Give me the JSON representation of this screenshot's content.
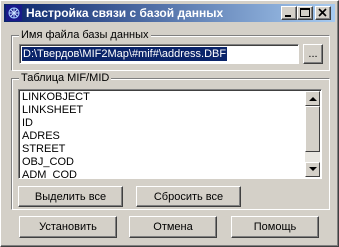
{
  "window": {
    "title": "Настройка связи с базой данных",
    "icon": "app-logo-icon"
  },
  "titlebar_buttons": {
    "minimize": "_",
    "maximize": "□",
    "close": "✕"
  },
  "file_group": {
    "label": "Имя файла базы данных",
    "path_value": "D:\\Твердов\\MIF2Map\\#mif#\\address.DBF",
    "browse_label": "..."
  },
  "table_group": {
    "label": "Таблица MIF/MID",
    "items": [
      "LINKOBJECT",
      "LINKSHEET",
      "ID",
      "ADRES",
      "STREET",
      "OBJ_COD",
      "ADM_COD"
    ],
    "select_all_label": "Выделить все",
    "reset_all_label": "Сбросить все"
  },
  "footer": {
    "ok_label": "Установить",
    "cancel_label": "Отмена",
    "help_label": "Помощь"
  }
}
